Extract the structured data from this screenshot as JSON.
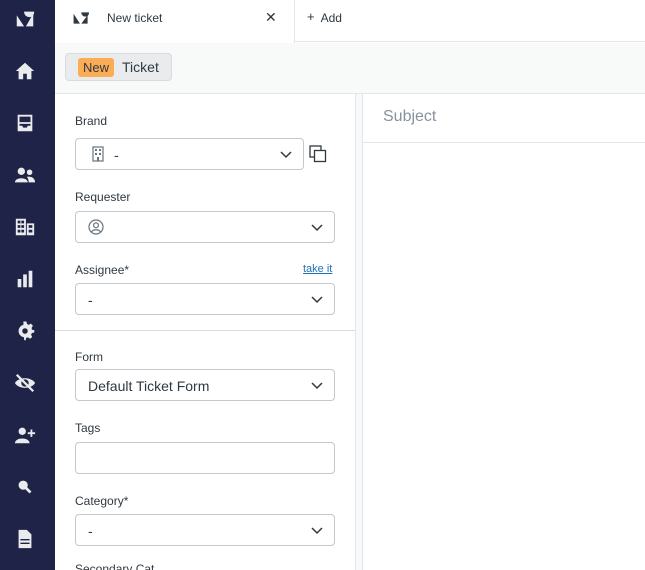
{
  "nav": {
    "items": [
      "logo-icon",
      "home-icon",
      "views-icon",
      "customers-icon",
      "organizations-icon",
      "reporting-icon",
      "admin-gear-icon",
      "eye-slash-icon",
      "add-user-icon",
      "search-icon",
      "document-icon"
    ]
  },
  "tabs": [
    {
      "title": "New ticket",
      "close": "✕"
    }
  ],
  "add_tab": {
    "plus": "+",
    "label": "Add"
  },
  "breadcrumb": {
    "badge": "New",
    "label": "Ticket"
  },
  "form": {
    "brand": {
      "label": "Brand",
      "value": "-"
    },
    "requester": {
      "label": "Requester",
      "value": ""
    },
    "assignee": {
      "label": "Assignee*",
      "link": "take it",
      "value": "-"
    },
    "form_select": {
      "label": "Form",
      "value": "Default Ticket Form"
    },
    "tags": {
      "label": "Tags",
      "value": ""
    },
    "category": {
      "label": "Category*",
      "value": "-"
    },
    "next_label": "Secondary Cat..."
  },
  "subject": {
    "placeholder": "Subject"
  },
  "colors": {
    "nav_bg": "#1f2348",
    "new_badge": "#fbad55",
    "link": "#1f73b7"
  }
}
